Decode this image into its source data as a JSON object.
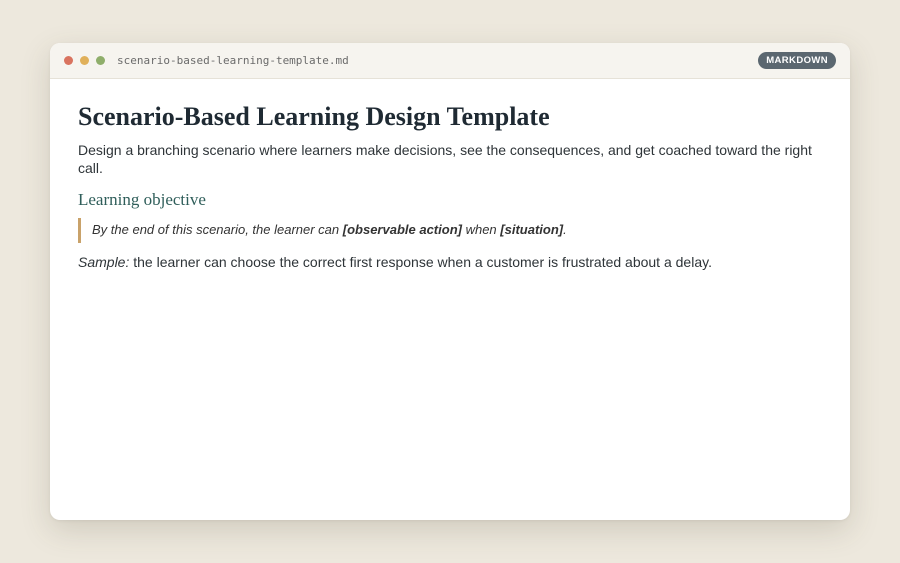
{
  "window": {
    "filename": "scenario-based-learning-template.md",
    "badge": "MARKDOWN"
  },
  "doc": {
    "title": "Scenario-Based Learning Design Template",
    "lead": "Design a branching scenario where learners make decisions, see the consequences, and get coached toward the right call.",
    "section_heading": "Learning objective",
    "objective": {
      "prefix": "By the end of this scenario, the learner can ",
      "action": "[observable action]",
      "middle": " when ",
      "situation": "[situation]",
      "suffix": "."
    },
    "sample": {
      "label": "Sample:",
      "text": " the learner can choose the correct first response when a customer is frustrated about a delay."
    }
  },
  "colors": {
    "background": "#ede8dd",
    "badge": "#5b6770",
    "heading_accent": "#2f5e5a",
    "quote_border": "#c9a26a",
    "dot_red": "#d9735f",
    "dot_yellow": "#e0b05a",
    "dot_green": "#8fae6b"
  }
}
